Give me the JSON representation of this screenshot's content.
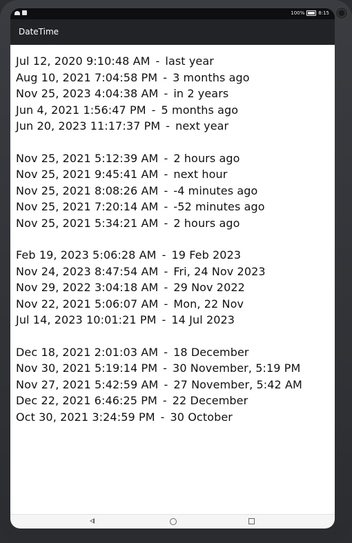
{
  "status_bar": {
    "battery_text": "100%",
    "time": "8:15"
  },
  "app": {
    "title": "DateTime"
  },
  "groups": [
    {
      "rows": [
        {
          "date": "Jul 12, 2020 9:10:48 AM",
          "relative": "last year"
        },
        {
          "date": "Aug 10, 2021 7:04:58 PM",
          "relative": "3 months ago"
        },
        {
          "date": "Nov 25, 2023 4:04:38 AM",
          "relative": "in 2 years"
        },
        {
          "date": "Jun 4, 2021 1:56:47 PM",
          "relative": "5 months ago"
        },
        {
          "date": "Jun 20, 2023 11:17:37 PM",
          "relative": "next year"
        }
      ]
    },
    {
      "rows": [
        {
          "date": "Nov 25, 2021 5:12:39 AM",
          "relative": "2 hours ago"
        },
        {
          "date": "Nov 25, 2021 9:45:41 AM",
          "relative": "next hour"
        },
        {
          "date": "Nov 25, 2021 8:08:26 AM",
          "relative": "-4 minutes ago"
        },
        {
          "date": "Nov 25, 2021 7:20:14 AM",
          "relative": "-52 minutes ago"
        },
        {
          "date": "Nov 25, 2021 5:34:21 AM",
          "relative": "2 hours ago"
        }
      ]
    },
    {
      "rows": [
        {
          "date": "Feb 19, 2023 5:06:28 AM",
          "relative": "19 Feb 2023"
        },
        {
          "date": "Nov 24, 2023 8:47:54 AM",
          "relative": "Fri, 24 Nov 2023"
        },
        {
          "date": "Nov 29, 2022 3:04:18 AM",
          "relative": "29 Nov 2022"
        },
        {
          "date": "Nov 22, 2021 5:06:07 AM",
          "relative": "Mon, 22 Nov"
        },
        {
          "date": "Jul 14, 2023 10:01:21 PM",
          "relative": "14 Jul 2023"
        }
      ]
    },
    {
      "rows": [
        {
          "date": "Dec 18, 2021 2:01:03 AM",
          "relative": "18 December"
        },
        {
          "date": "Nov 30, 2021 5:19:14 PM",
          "relative": "30 November, 5:19 PM"
        },
        {
          "date": "Nov 27, 2021 5:42:59 AM",
          "relative": "27 November, 5:42 AM"
        },
        {
          "date": "Dec 22, 2021 6:46:25 PM",
          "relative": "22 December"
        },
        {
          "date": "Oct 30, 2021 3:24:59 PM",
          "relative": "30 October"
        }
      ]
    }
  ],
  "separator": "-",
  "nav": {
    "back_icon": "back-triangle-icon",
    "home_icon": "home-circle-icon",
    "recents_icon": "recents-square-icon"
  }
}
